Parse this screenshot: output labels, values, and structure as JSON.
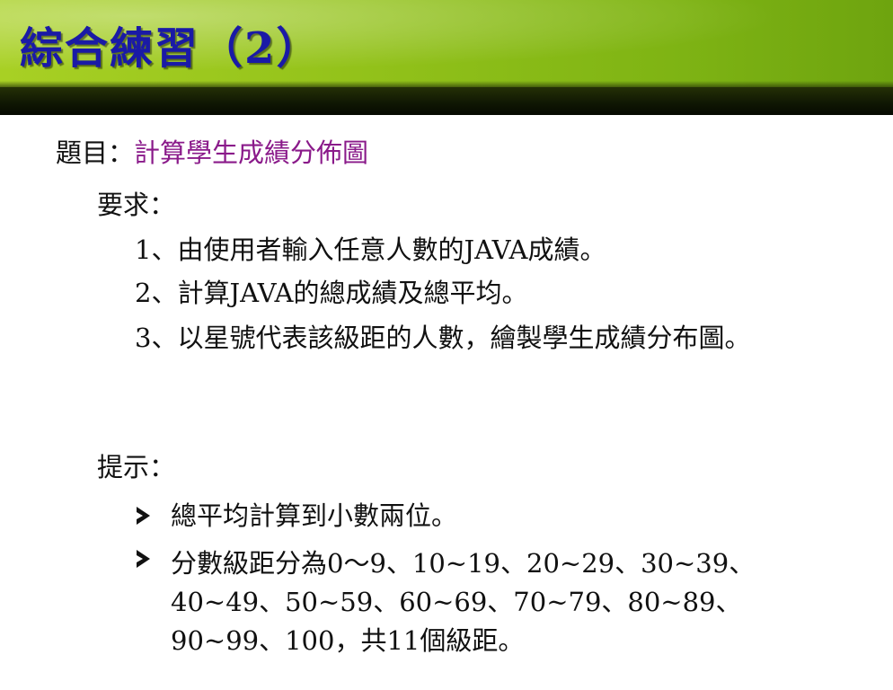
{
  "slide": {
    "title": "綜合練習（2）",
    "topic": {
      "label": "題目：",
      "text": "計算學生成績分佈圖"
    },
    "requirements": {
      "heading": "要求：",
      "items": [
        "1、由使用者輸入任意人數的JAVA成績。",
        "2、計算JAVA的總成績及總平均。",
        "3、以星號代表該級距的人數，繪製學生成績分布圖。"
      ]
    },
    "hints": {
      "heading": "提示：",
      "items": [
        "總平均計算到小數兩位。",
        "分數級距分為0～9、10~19、20~29、30~39、40~49、50~59、60~69、70~79、80~89、90~99、100，共11個級距。"
      ]
    }
  },
  "colors": {
    "title": "#1a1aa6",
    "topic_text": "#8a1a8a",
    "header_green": "#93c21a",
    "header_band": "#0f1603",
    "body_text": "#111111"
  },
  "icons": {
    "bullet": "arrowhead-bullet-icon"
  }
}
